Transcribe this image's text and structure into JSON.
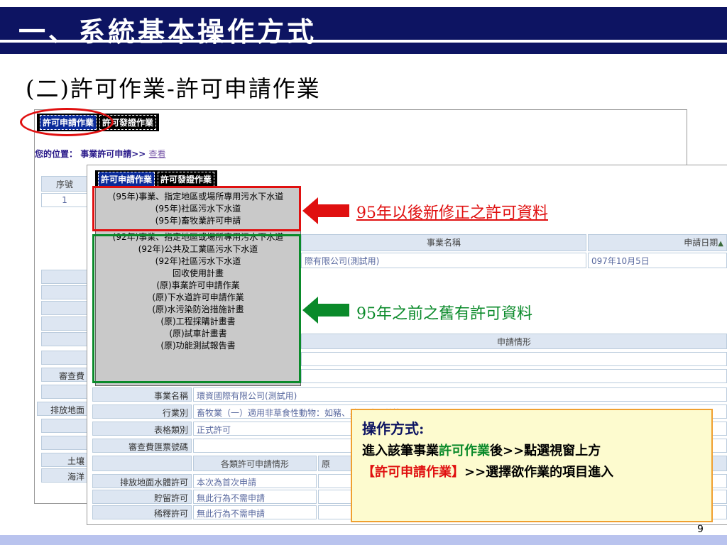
{
  "slide": {
    "title": "一、系統基本操作方式",
    "subtitle": "(二)許可作業-許可申請作業",
    "page_number": "9"
  },
  "back_window": {
    "tabs": [
      "許可申請作業",
      "許可發證作業"
    ],
    "location_label": "您的位置：",
    "location_path": "事業許可申請>>",
    "location_link": "查看",
    "header_seq": "序號",
    "row_seq": "1",
    "label_review_fee": "審查費",
    "label_discharge": "排放地面",
    "label_soil": "土壤",
    "label_ocean": "海洋"
  },
  "front_window": {
    "tabs": [
      "許可申請作業",
      "許可發證作業"
    ],
    "menu_new": [
      "(95年)事業、指定地區或場所專用污水下水道",
      "(95年)社區污水下水道",
      "(95年)畜牧業許可申請"
    ],
    "menu_old": [
      "(92年)事業、指定地區或場所專用污水下水道",
      "(92年)公共及工業區污水下水道",
      "(92年)社區污水下水道",
      "回收使用計畫",
      "(原)事業許可申請作業",
      "(原)下水道許可申請作業",
      "(原)水污染防治措施計畫",
      "(原)工程採購計畫書",
      "(原)試車計畫書",
      "(原)功能測試報告書"
    ],
    "col_business_name": "事業名稱",
    "col_apply_date": "申請日期",
    "sort_indicator": "▲",
    "row_business_name": "際有限公司(測試用)",
    "row_apply_date": "097年10月5日",
    "section_apply_status": "申請情形",
    "field_business_name_label": "事業名稱",
    "field_business_name_value": "環資國際有限公司(測試用)",
    "field_industry_label": "行業別",
    "field_industry_value": "畜牧業（一）適用非草食性動物：如豬、雞、鴨、鵝等",
    "field_form_type_label": "表格類別",
    "field_form_type_value": "正式許可",
    "field_fee_no_label": "審查費匯票號碼",
    "section_each_permit": "各類許可申請情形",
    "section_each_permit_right": "原",
    "permit_rows": [
      {
        "label": "排放地面水體許可",
        "value": "本次為首次申請"
      },
      {
        "label": "貯留許可",
        "value": "無此行為不需申請"
      },
      {
        "label": "稀釋許可",
        "value": "無此行為不需申請"
      }
    ]
  },
  "annotations": {
    "new_data_note": "95年以後新修正之許可資料",
    "old_data_note": "95年之前之舊有許可資料",
    "instructions_title": "操作方式:",
    "instructions_part1": "進入該筆事業",
    "instructions_part2": "許可作業",
    "instructions_part3": "後>>點選視窗上方",
    "instructions_part4": "【許可申請作業】",
    "instructions_part5": ">>選擇欲作業的項目進入"
  },
  "colors": {
    "title_navy": "#0d1462",
    "highlight_red": "#e01010",
    "highlight_green": "#0a8a2a",
    "note_box_bg": "#fdfbcf",
    "note_box_border": "#f0a030",
    "menu_bg": "#c9c9c9",
    "active_tab": "#0a2a9a",
    "bottom_strip": "#b9c3ee"
  },
  "icons": [
    "red-arrow-left-icon",
    "green-arrow-left-icon",
    "sort-ascending-icon"
  ]
}
